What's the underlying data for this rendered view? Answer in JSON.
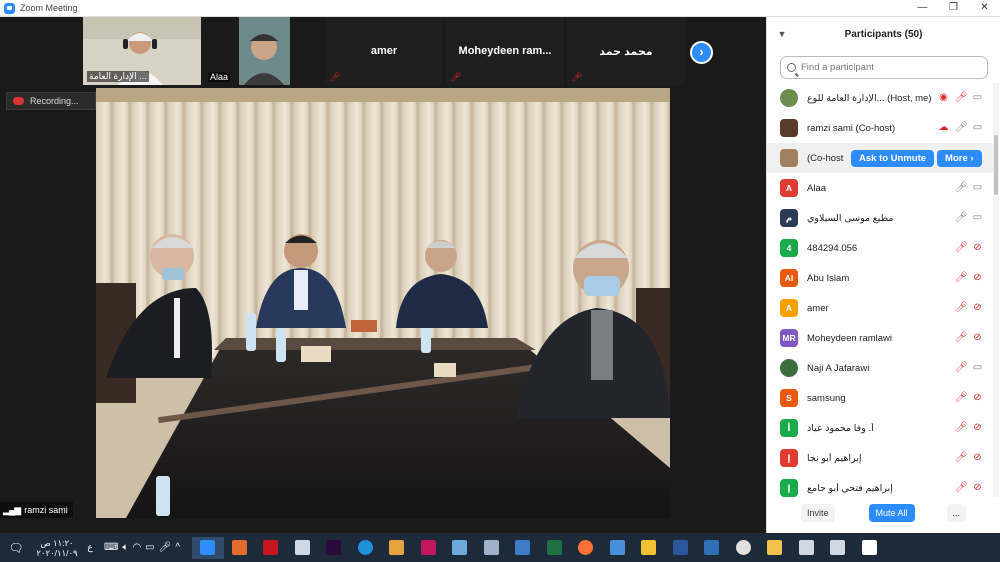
{
  "window": {
    "title": "Zoom Meeting",
    "controls": [
      "—",
      "❐",
      "✕"
    ]
  },
  "gallery": {
    "tiles": [
      {
        "caption": "الإدارة العامة ...",
        "type": "video",
        "muted": true
      },
      {
        "caption": "Alaa",
        "type": "video",
        "muted": false
      },
      {
        "name": "amer",
        "type": "name",
        "muted": true
      },
      {
        "name": "Moheydeen  ram...",
        "type": "name",
        "muted": true
      },
      {
        "name": "محمد حمد",
        "type": "name",
        "muted": true
      }
    ],
    "next_label": "›"
  },
  "recording": {
    "label": "Recording..."
  },
  "active_speaker": {
    "name": "ramzi sami"
  },
  "participants_panel": {
    "title": "Participants (50)",
    "search_placeholder": "Find a participant",
    "participants": [
      {
        "name": "الإدارة العامة للوع... (Host, me)",
        "avatar_letter": "",
        "avatar_color": "#6b8e4e",
        "mic": "muted",
        "video": "on",
        "recording": true
      },
      {
        "name": "ramzi sami (Co-host)",
        "avatar_letter": "",
        "avatar_color": "#5a3b2a",
        "mic": "on",
        "video": "on",
        "cloud": true
      },
      {
        "name": "(Co-host",
        "avatar_letter": "",
        "avatar_color": "#a08060",
        "highlight": true,
        "ask_label": "Ask to Unmute",
        "more_label": "More ›"
      },
      {
        "name": "Alaa",
        "avatar_letter": "A",
        "avatar_color": "#e03c31",
        "mic": "on",
        "video": "on"
      },
      {
        "name": "مطيع موسى السيلاوي",
        "avatar_letter": "م",
        "avatar_color": "#2b3a55",
        "mic": "on",
        "video": "on"
      },
      {
        "name": "484294.056",
        "avatar_letter": "4",
        "avatar_color": "#1aab4a",
        "mic": "muted",
        "video": "off"
      },
      {
        "name": "Abu Islam",
        "avatar_letter": "AI",
        "avatar_color": "#e8590c",
        "mic": "muted",
        "video": "off"
      },
      {
        "name": "amer",
        "avatar_letter": "A",
        "avatar_color": "#f59f00",
        "mic": "muted",
        "video": "off"
      },
      {
        "name": "Moheydeen ramlawi",
        "avatar_letter": "MR",
        "avatar_color": "#7e57c2",
        "mic": "muted",
        "video": "off"
      },
      {
        "name": "Naji A Jafarawi",
        "avatar_letter": "",
        "avatar_color": "#3c6e3c",
        "mic": "muted",
        "video": "on"
      },
      {
        "name": "samsung",
        "avatar_letter": "S",
        "avatar_color": "#e8590c",
        "mic": "muted",
        "video": "off"
      },
      {
        "name": "أ. وفا محمود عياد",
        "avatar_letter": "أ",
        "avatar_color": "#1aab4a",
        "mic": "muted",
        "video": "off"
      },
      {
        "name": "إبراهيم أبو نجا",
        "avatar_letter": "إ",
        "avatar_color": "#e03c31",
        "mic": "muted",
        "video": "off"
      },
      {
        "name": "إبراهيم فتحي أبو جامع",
        "avatar_letter": "إ",
        "avatar_color": "#1aab4a",
        "mic": "muted",
        "video": "off"
      }
    ],
    "footer": {
      "invite_label": "Invite",
      "mute_all_label": "Mute All",
      "more_label": "..."
    }
  },
  "taskbar": {
    "clock_time": "١١:٢٠ ص",
    "clock_date": "٢٠٢٠/١١/٠٩",
    "lang": "ع",
    "apps": [
      {
        "name": "zoom-icon",
        "color": "#2d8cff"
      },
      {
        "name": "sketch-icon",
        "color": "#e36b2b"
      },
      {
        "name": "acrobat-icon",
        "color": "#c4161c"
      },
      {
        "name": "settings-icon",
        "color": "#cfd8e3"
      },
      {
        "name": "premiere-icon",
        "color": "#2a0a3a"
      },
      {
        "name": "edge-icon",
        "color": "#1e90d6"
      },
      {
        "name": "media-player-icon",
        "color": "#e6a23c"
      },
      {
        "name": "qr-app-icon",
        "color": "#c2185b"
      },
      {
        "name": "notes-icon",
        "color": "#6fa8dc"
      },
      {
        "name": "calculator-icon",
        "color": "#9fb3c8"
      },
      {
        "name": "remote-desktop-icon",
        "color": "#3d7dc8"
      },
      {
        "name": "excel-icon",
        "color": "#1d7044"
      },
      {
        "name": "firefox-icon",
        "color": "#ff7139"
      },
      {
        "name": "mail-icon",
        "color": "#4a90d9"
      },
      {
        "name": "notepad-icon",
        "color": "#f1c232"
      },
      {
        "name": "word-icon",
        "color": "#2b579a"
      },
      {
        "name": "store-icon",
        "color": "#2f6db5"
      },
      {
        "name": "chrome-icon",
        "color": "#e0e0e0"
      },
      {
        "name": "file-explorer-icon",
        "color": "#f2c14e"
      },
      {
        "name": "task-view-icon",
        "color": "#cfd8e3"
      },
      {
        "name": "search-icon",
        "color": "#cfd8e3"
      },
      {
        "name": "start-icon",
        "color": "#ffffff"
      }
    ]
  }
}
